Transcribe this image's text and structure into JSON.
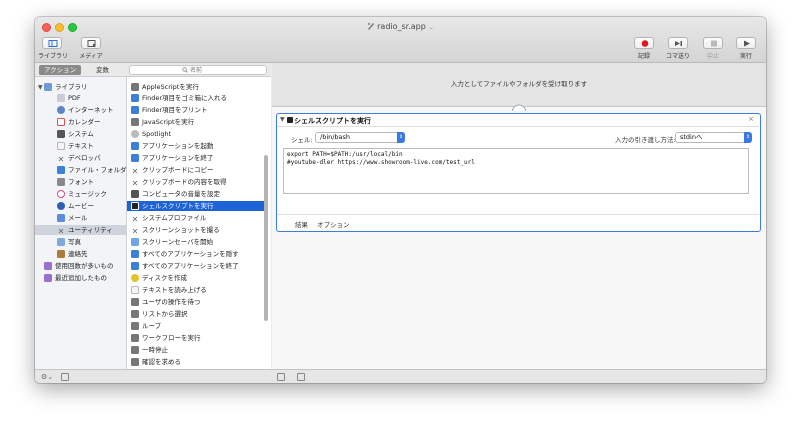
{
  "window": {
    "title": "radio_sr.app"
  },
  "toolbar": {
    "left_labels": [
      "ライブラリ",
      "メディア"
    ],
    "right_buttons": [
      {
        "label": "記録",
        "icon": "record-icon",
        "enabled": true
      },
      {
        "label": "コマ送り",
        "icon": "step-icon",
        "enabled": true
      },
      {
        "label": "中止",
        "icon": "stop-icon",
        "enabled": false
      },
      {
        "label": "実行",
        "icon": "play-icon",
        "enabled": true
      }
    ]
  },
  "library": {
    "tabs": [
      "アクション",
      "変数"
    ],
    "search_placeholder": "名前",
    "categories": [
      {
        "label": "ライブラリ",
        "icon": "library-icon",
        "color": "#6f9bd8"
      },
      {
        "label": "PDF",
        "icon": "pdf-icon",
        "color": "#c9cdd6"
      },
      {
        "label": "インターネット",
        "icon": "globe-icon",
        "color": "#5e86c7"
      },
      {
        "label": "カレンダー",
        "icon": "calendar-icon",
        "color": "#d9534f"
      },
      {
        "label": "システム",
        "icon": "system-icon",
        "color": "#555555"
      },
      {
        "label": "テキスト",
        "icon": "text-icon",
        "color": "#b8b8b8"
      },
      {
        "label": "デベロッパ",
        "icon": "developer-icon",
        "color": "#777777"
      },
      {
        "label": "ファイル・フォルダ",
        "icon": "finder-icon",
        "color": "#3c80d8"
      },
      {
        "label": "フォント",
        "icon": "font-icon",
        "color": "#8a8a8a"
      },
      {
        "label": "ミュージック",
        "icon": "music-icon",
        "color": "#d9468d"
      },
      {
        "label": "ムービー",
        "icon": "movie-icon",
        "color": "#2d5fb3"
      },
      {
        "label": "メール",
        "icon": "mail-icon",
        "color": "#5a8ddc"
      },
      {
        "label": "ユーティリティ",
        "icon": "utility-icon",
        "color": "#777777"
      },
      {
        "label": "写真",
        "icon": "photo-icon",
        "color": "#7fa9dd"
      },
      {
        "label": "連絡先",
        "icon": "contacts-icon",
        "color": "#b07a3a"
      },
      {
        "label": "使用回数が多いもの",
        "icon": "folder-icon",
        "color": "#9b6fd0"
      },
      {
        "label": "最近追加したもの",
        "icon": "folder-icon",
        "color": "#9b6fd0"
      }
    ],
    "actions": [
      "AppleScriptを実行",
      "Finder項目をゴミ箱に入れる",
      "Finder項目をプリント",
      "JavaScriptを実行",
      "Spotlight",
      "アプリケーションを起動",
      "アプリケーションを終了",
      "クリップボードにコピー",
      "クリップボードの内容を取得",
      "コンピュータの音量を設定",
      "シェルスクリプトを実行",
      "システムプロファイル",
      "スクリーンショットを撮る",
      "スクリーンセーバを開始",
      "すべてのアプリケーションを隠す",
      "すべてのアプリケーションを終了",
      "ディスクを作成",
      "テキストを読み上げる",
      "ユーザの操作を待つ",
      "リストから選択",
      "ループ",
      "ワークフローを実行",
      "一時停止",
      "確認を求める",
      "結果を表示"
    ]
  },
  "workflow": {
    "receives_text": "入力としてファイルやフォルダを受け取ります",
    "action": {
      "title": "シェルスクリプトを実行",
      "shell_label": "シェル:",
      "shell_value": "/bin/bash",
      "pass_input_label": "入力の引き渡し方法:",
      "pass_input_value": "stdinへ",
      "script_lines": [
        "export PATH=$PATH:/usr/local/bin",
        "#youtube-dler https://www.showroom-live.com/test_url"
      ],
      "footer_tabs": [
        "結果",
        "オプション"
      ]
    }
  }
}
